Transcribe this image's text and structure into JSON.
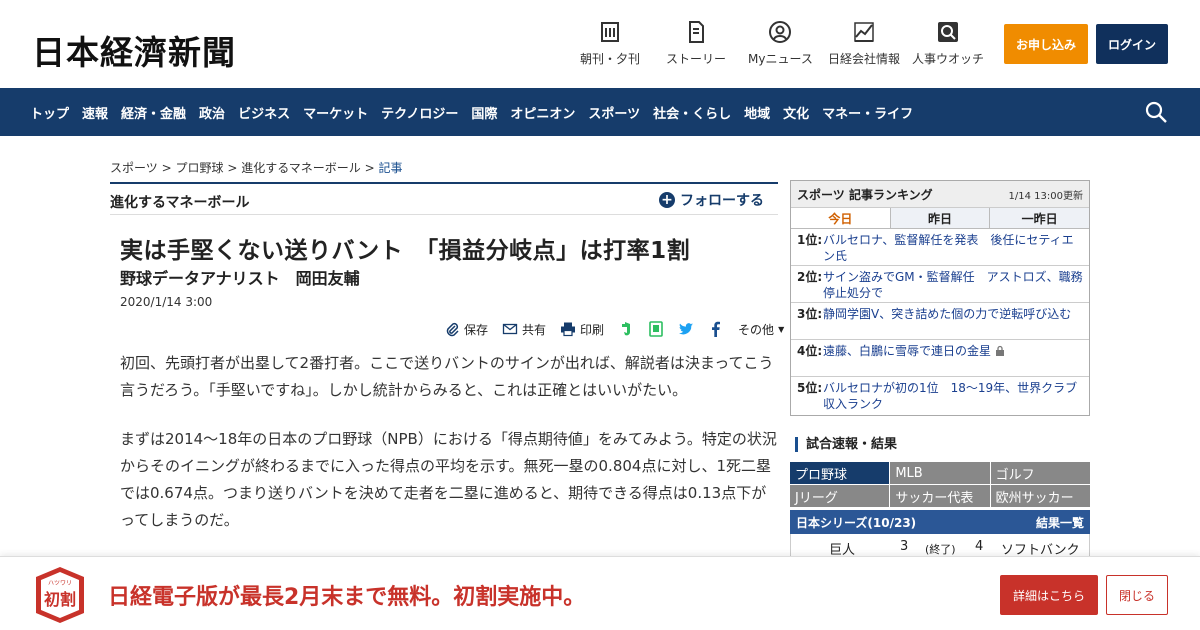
{
  "header": {
    "logo": "日本経濟新聞",
    "links": [
      {
        "label": "朝刊・夕刊",
        "icon": "newspaper-icon"
      },
      {
        "label": "ストーリー",
        "icon": "document-icon"
      },
      {
        "label": "Myニュース",
        "icon": "user-icon"
      },
      {
        "label": "日経会社情報",
        "icon": "chart-icon"
      },
      {
        "label": "人事ウオッチ",
        "icon": "search-person-icon"
      }
    ],
    "subscribe": "お申し込み",
    "login": "ログイン"
  },
  "nav": {
    "items": [
      "トップ",
      "速報",
      "経済・金融",
      "政治",
      "ビジネス",
      "マーケット",
      "テクノロジー",
      "国際",
      "オピニオン",
      "スポーツ",
      "社会・くらし",
      "地域",
      "文化",
      "マネー・ライフ"
    ],
    "search_icon": "search-icon"
  },
  "breadcrumb": {
    "items": [
      "スポーツ",
      "プロ野球",
      "進化するマネーボール"
    ],
    "separator": ">",
    "current": "記事"
  },
  "series": {
    "title": "進化するマネーボール",
    "follow": "フォローする"
  },
  "article": {
    "headline": "実は手堅くない送りバント　「損益分岐点」は打率1割",
    "byline": "野球データアナリスト　岡田友輔",
    "date": "2020/1/14 3:00",
    "share": {
      "save": "保存",
      "share": "共有",
      "print": "印刷",
      "more": "その他"
    },
    "paragraphs": [
      "初回、先頭打者が出塁して2番打者。ここで送りバントのサインが出れば、解説者は決まってこう言うだろう。「手堅いですね」。しかし統計からみると、これは正確とはいいがたい。",
      "まずは2014～18年の日本のプロ野球（NPB）における「得点期待値」をみてみよう。特定の状況からそのイニングが終わるまでに入った得点の平均を示す。無死一塁の0.804点に対し、1死二塁では0.674点。つまり送りバントを決めて走者を二塁に進めると、期待できる得点は0.13点下がってしまうのだ。"
    ]
  },
  "ranking": {
    "title": "スポーツ 記事ランキング",
    "time": "1/14 13:00更新",
    "tabs": [
      "今日",
      "昨日",
      "一昨日"
    ],
    "items": [
      {
        "rank": "1位:",
        "text": "バルセロナ、監督解任を発表　後任にセティエン氏"
      },
      {
        "rank": "2位:",
        "text": "サイン盗みでGM・監督解任　アストロズ、職務停止処分で"
      },
      {
        "rank": "3位:",
        "text": "静岡学園V、突き詰めた個の力で逆転呼び込む"
      },
      {
        "rank": "4位:",
        "text": "遠藤、白鵬に雪辱で連日の金星"
      },
      {
        "rank": "5位:",
        "text": "バルセロナが初の1位　18～19年、世界クラブ収入ランク"
      }
    ]
  },
  "scores": {
    "title": "試合速報・結果",
    "categories": [
      "プロ野球",
      "MLB",
      "ゴルフ",
      "Jリーグ",
      "サッカー代表",
      "欧州サッカー"
    ],
    "series_label": "日本シリーズ(10/23)",
    "results_link": "結果一覧",
    "game": {
      "home": "巨人",
      "home_score": "3",
      "status": "(終了)",
      "away_score": "4",
      "away": "ソフトバンク"
    }
  },
  "banner": {
    "badge_top": "ハツワリ",
    "badge": "初割",
    "text": "日経電子版が最長2月末まで無料。初割実施中。",
    "detail": "詳細はこちら",
    "close": "閉じる"
  },
  "colors": {
    "nav_bg": "#163c6b",
    "subscribe": "#f08c00",
    "banner_red": "#c8322a",
    "link_blue": "#1a3f8f"
  }
}
